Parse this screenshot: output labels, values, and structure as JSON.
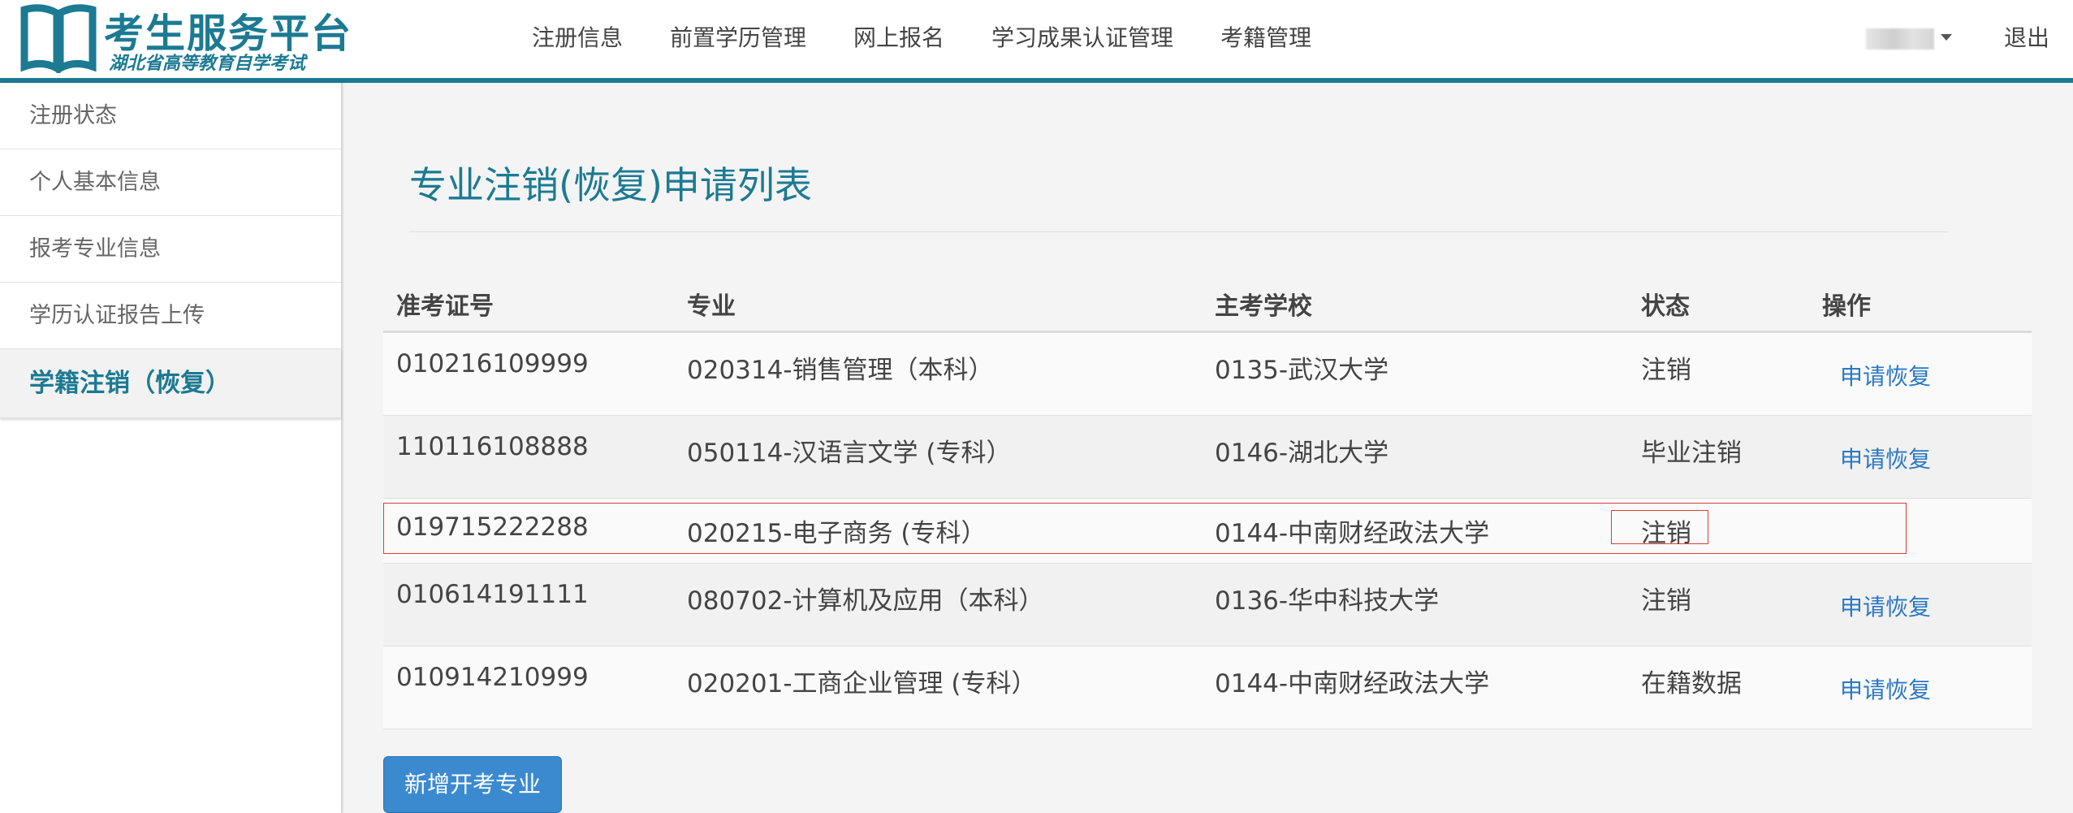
{
  "header": {
    "logo_title": "考生服务平台",
    "logo_subtitle": "湖北省高等教育自学考试",
    "nav": [
      "注册信息",
      "前置学历管理",
      "网上报名",
      "学习成果认证管理",
      "考籍管理"
    ],
    "logout": "退出"
  },
  "sidebar": {
    "items": [
      {
        "label": "注册状态"
      },
      {
        "label": "个人基本信息"
      },
      {
        "label": "报考专业信息"
      },
      {
        "label": "学历认证报告上传"
      },
      {
        "label": "学籍注销（恢复）"
      }
    ]
  },
  "main": {
    "title": "专业注销(恢复)申请列表",
    "table": {
      "headers": [
        "准考证号",
        "专业",
        "主考学校",
        "状态",
        "操作"
      ],
      "rows": [
        {
          "id": "010216109999",
          "major": "020314-销售管理（本科）",
          "school": "0135-武汉大学",
          "status": "注销",
          "action": "申请恢复"
        },
        {
          "id": "110116108888",
          "major": "050114-汉语言文学 (专科）",
          "school": "0146-湖北大学",
          "status": "毕业注销",
          "action": "申请恢复"
        },
        {
          "id": "019715222288",
          "major": "020215-电子商务 (专科）",
          "school": "0144-中南财经政法大学",
          "status": "注销",
          "action": ""
        },
        {
          "id": "010614191111",
          "major": "080702-计算机及应用（本科）",
          "school": "0136-华中科技大学",
          "status": "注销",
          "action": "申请恢复"
        },
        {
          "id": "010914210999",
          "major": "020201-工商企业管理 (专科）",
          "school": "0144-中南财经政法大学",
          "status": "在籍数据",
          "action": "申请恢复"
        }
      ]
    },
    "add_button": "新增开考专业"
  },
  "colors": {
    "brand": "#1c7a92",
    "link": "#2a78c4",
    "button": "#3b8ad0",
    "highlight": "#e03b3b"
  }
}
